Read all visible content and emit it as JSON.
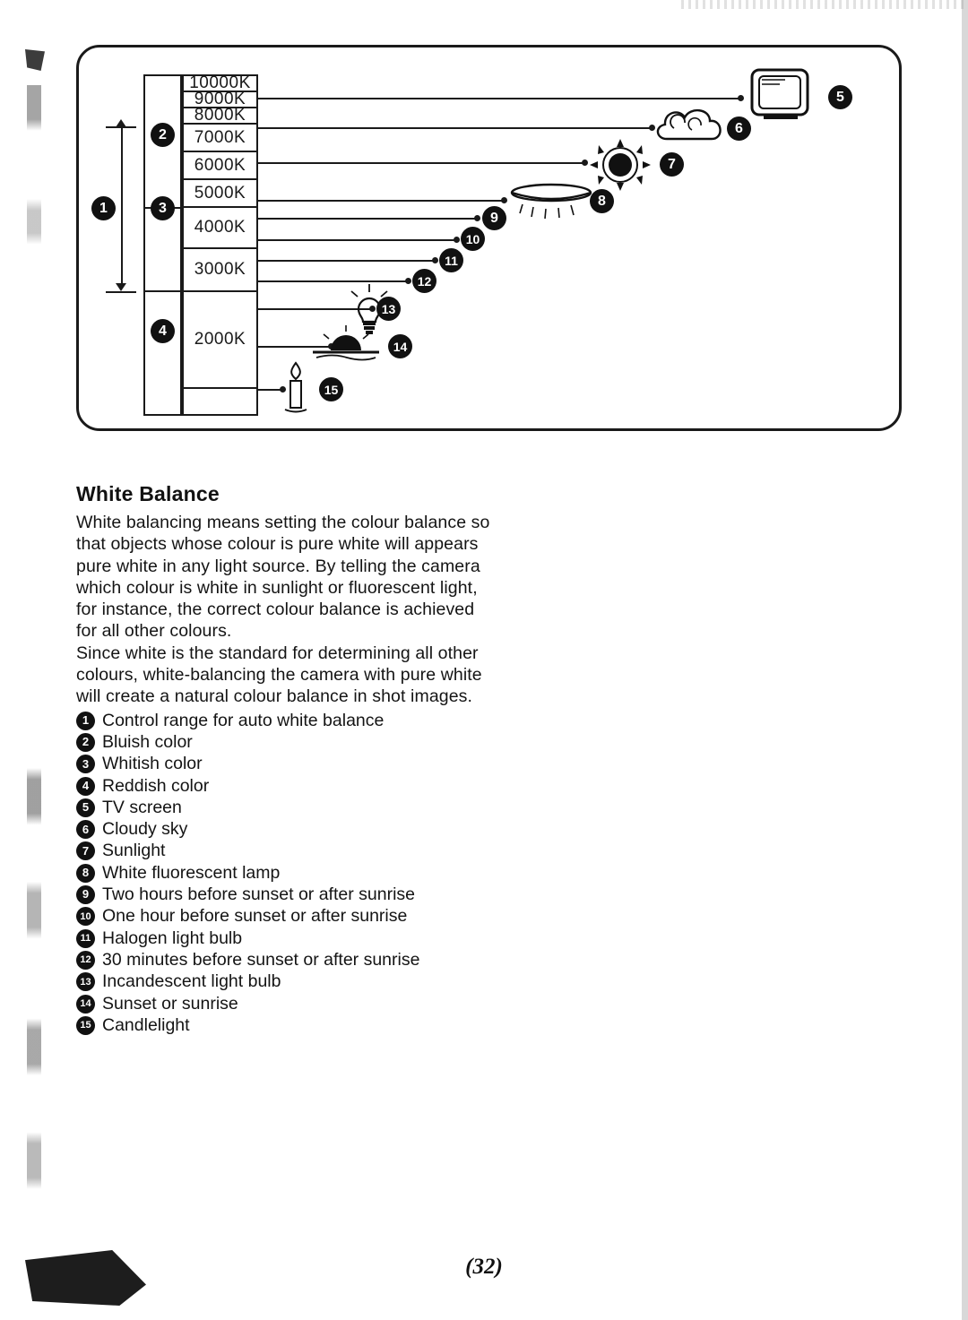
{
  "page": {
    "number": "(32)"
  },
  "diagram": {
    "name": "colour-temperature-chart",
    "temperature_scale": [
      "10000K",
      "9000K",
      "8000K",
      "7000K",
      "6000K",
      "5000K",
      "4000K",
      "3000K",
      "2000K"
    ],
    "markers": [
      {
        "n": "1",
        "label": "Control range for auto white balance"
      },
      {
        "n": "2",
        "label": "Bluish color"
      },
      {
        "n": "3",
        "label": "Whitish color"
      },
      {
        "n": "4",
        "label": "Reddish color"
      },
      {
        "n": "5",
        "label": "TV screen"
      },
      {
        "n": "6",
        "label": "Cloudy sky"
      },
      {
        "n": "7",
        "label": "Sunlight"
      },
      {
        "n": "8",
        "label": "White fluorescent lamp"
      },
      {
        "n": "9",
        "label": "Two hours before sunset or after sunrise"
      },
      {
        "n": "10",
        "label": "One hour before sunset or after sunrise"
      },
      {
        "n": "11",
        "label": "Halogen light bulb"
      },
      {
        "n": "12",
        "label": "30 minutes before sunset or after sunrise"
      },
      {
        "n": "13",
        "label": "Incandescent light bulb"
      },
      {
        "n": "14",
        "label": "Sunset or sunrise"
      },
      {
        "n": "15",
        "label": "Candlelight"
      }
    ]
  },
  "section": {
    "title": "White Balance",
    "paragraphs": [
      "White balancing means setting the colour balance so that objects whose colour is pure white will appears pure white in any light source. By telling the camera which colour is white in sunlight or fluorescent light, for instance, the correct colour balance is achieved for all other colours.",
      "Since white is the standard for determining all other colours, white-balancing the camera with pure white will create a natural colour balance in shot images."
    ]
  }
}
